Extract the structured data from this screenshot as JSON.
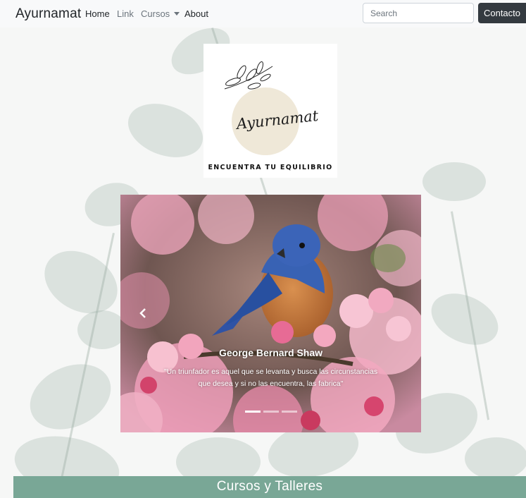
{
  "navbar": {
    "brand": "Ayurnamat",
    "links": [
      {
        "label": "Home",
        "active": true
      },
      {
        "label": "Link",
        "active": false
      },
      {
        "label": "Cursos",
        "active": false,
        "dropdown": true
      },
      {
        "label": "About",
        "active": false
      }
    ],
    "search_placeholder": "Search",
    "contact_label": "Contacto"
  },
  "logo": {
    "script_text": "Ayurnamat",
    "tagline": "ENCUENTRA TU EQUILIBRIO"
  },
  "carousel": {
    "caption_title": "George Bernard Shaw",
    "caption_text": "\"Un triunfador es aquel que se levanta y busca las circunstancias que desea y si no las encuentra, las fabrica\"",
    "slide_count": 3,
    "active_index": 0,
    "prev_icon": "chevron-left-icon"
  },
  "section": {
    "title": "Cursos y Talleres",
    "color": "#79a796"
  },
  "colors": {
    "navbar_bg": "#f8f9fa",
    "button_dark": "#343a40"
  }
}
